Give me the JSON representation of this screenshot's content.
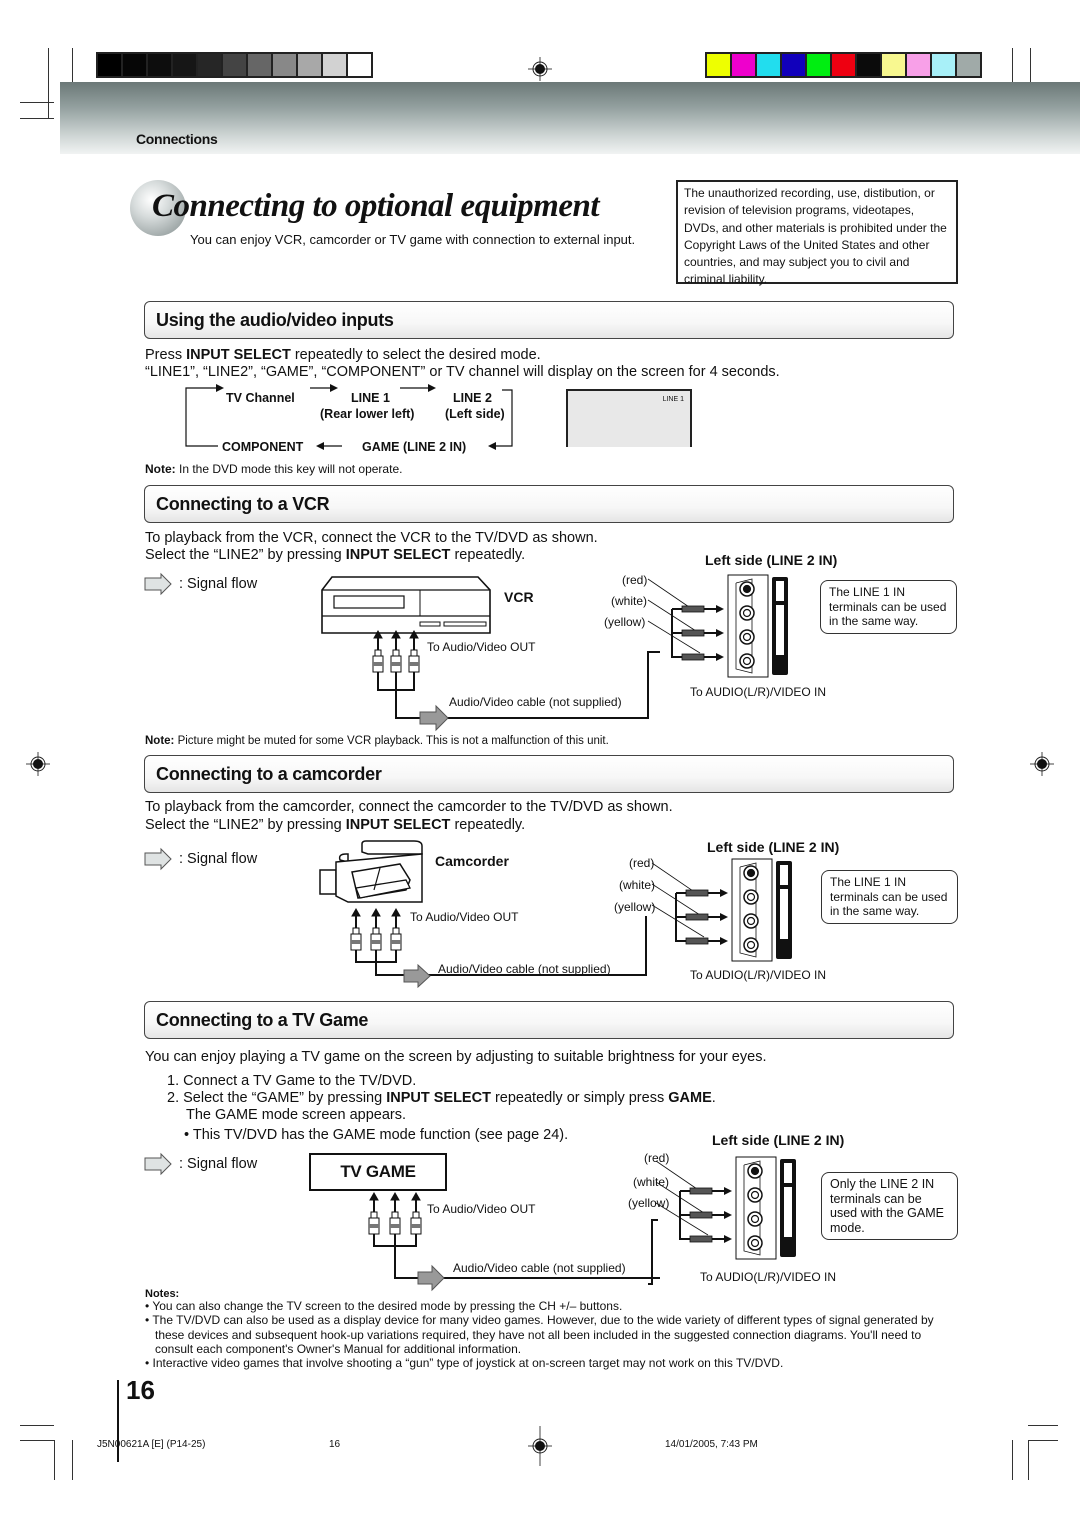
{
  "print_marks": {
    "grayscale_swatches": [
      "#000000",
      "#060606",
      "#0d0d0d",
      "#161616",
      "#262626",
      "#444444",
      "#666666",
      "#888888",
      "#a8a8a8",
      "#d2d2d2",
      "#ffffff"
    ],
    "color_swatches": [
      "#eeff00",
      "#ee00cc",
      "#22ddee",
      "#1100bb",
      "#00ee11",
      "#ee0011",
      "#0b0b0b",
      "#f8f890",
      "#f8a0e8",
      "#a8f0f8",
      "#a0aaa8"
    ]
  },
  "header": {
    "section_label": "Connections",
    "band_color": "#6b7877"
  },
  "title": {
    "text": "Connecting to optional equipment",
    "intro": "You can enjoy VCR, camcorder or TV game with connection to external input."
  },
  "warning_box": {
    "text": "The unauthorized recording, use, distibution, or revision of television programs, videotapes, DVDs, and other materials is prohibited under the Copyright Laws of the United States and other countries, and may subject you to civil and criminal liability."
  },
  "sections": {
    "av_inputs": {
      "heading": "Using the audio/video inputs",
      "line1_pre": "Press ",
      "line1_bold": "INPUT SELECT",
      "line1_post": " repeatedly to select the desired mode.",
      "line2": "“LINE1”, “LINE2”, “GAME”, “COMPONENT” or TV channel will display on the screen for 4 seconds.",
      "flow": {
        "tv_channel": "TV Channel",
        "line1": "LINE 1",
        "line2": "LINE 2",
        "line1_sub": "(Rear lower left)",
        "line2_sub": "(Left side)",
        "component": "COMPONENT",
        "game": "GAME (LINE 2 IN)"
      },
      "screen_label": "LINE 1",
      "note_label": "Note:",
      "note_text": " In the DVD mode this key will not operate."
    },
    "vcr": {
      "heading": "Connecting to a VCR",
      "line1": "To playback from the VCR, connect the VCR to the TV/DVD as shown.",
      "line2_pre": "Select the “LINE2” by pressing ",
      "line2_bold": "INPUT SELECT",
      "line2_post": " repeatedly.",
      "signal_flow": ": Signal flow",
      "device_label": "VCR",
      "out_label": "To Audio/Video OUT",
      "cable_label": "Audio/Video cable  (not supplied)",
      "jack_title": "Left side (LINE 2 IN)",
      "colors": [
        "(red)",
        "(white)",
        "(yellow)"
      ],
      "in_label": "To AUDIO(L/R)/VIDEO IN",
      "callout": "The LINE 1 IN terminals can be used in the same way.",
      "note_label": "Note:",
      "note_text": " Picture might be muted for some VCR playback. This is not a malfunction of this unit."
    },
    "camcorder": {
      "heading": "Connecting to a camcorder",
      "line1": "To playback from the camcorder, connect the camcorder to the TV/DVD as shown.",
      "line2_pre": "Select the “LINE2” by pressing ",
      "line2_bold": "INPUT SELECT",
      "line2_post": " repeatedly.",
      "signal_flow": ": Signal flow",
      "device_label": "Camcorder",
      "out_label": "To Audio/Video OUT",
      "cable_label": "Audio/Video cable (not supplied)",
      "jack_title": "Left side (LINE 2 IN)",
      "colors": [
        "(red)",
        "(white)",
        "(yellow)"
      ],
      "in_label": "To AUDIO(L/R)/VIDEO IN",
      "callout": "The LINE 1 IN terminals can be used in the same way."
    },
    "tv_game": {
      "heading": "Connecting to a TV Game",
      "intro": "You can enjoy playing a TV game on the screen by adjusting to suitable brightness for your eyes.",
      "step1": "1.  Connect a TV Game to the TV/DVD.",
      "step2_pre": "2.  Select the “GAME” by pressing ",
      "step2_bold1": "INPUT SELECT",
      "step2_mid": " repeatedly or simply press ",
      "step2_bold2": "GAME",
      "step2_post": ".",
      "step2_sub": "The GAME mode screen appears.",
      "bullet": "• This TV/DVD has the GAME mode function (see page 24).",
      "signal_flow": ": Signal flow",
      "device_label": "TV GAME",
      "out_label": "To Audio/Video OUT",
      "cable_label": "Audio/Video cable (not supplied)",
      "jack_title": "Left side (LINE 2 IN)",
      "colors": [
        "(red)",
        "(white)",
        "(yellow)"
      ],
      "in_label": "To AUDIO(L/R)/VIDEO IN",
      "callout": "Only the LINE 2 IN terminals can be used with the GAME mode."
    }
  },
  "notes": {
    "heading": "Notes:",
    "items": [
      "You can also change the TV screen to the desired mode by pressing the CH +/– buttons.",
      "The TV/DVD can also be used as a display device for many video games. However, due to the wide variety of different types of signal generated by these devices and subsequent hook-up variations required, they have not all been included in the suggested connection diagrams. You'll need to consult each component's Owner's Manual for additional information.",
      "Interactive video games that involve shooting a “gun” type of joystick at on-screen target may not work on this TV/DVD."
    ]
  },
  "page_number": "16",
  "footer": {
    "doc_code": "J5N00621A [E] (P14-25)",
    "page": "16",
    "timestamp": "14/01/2005, 7:43 PM"
  }
}
